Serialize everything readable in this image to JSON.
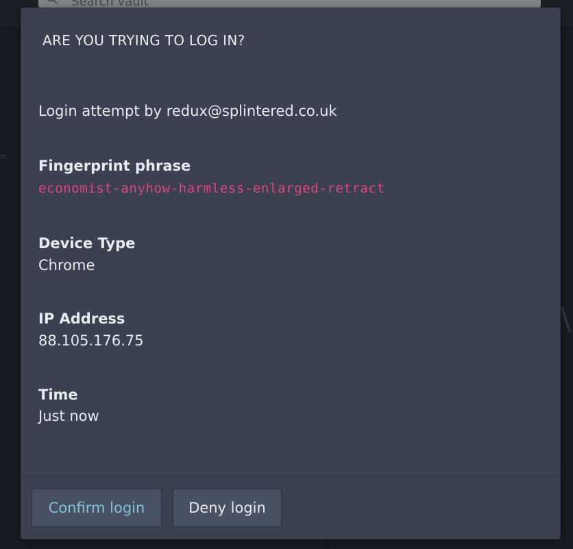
{
  "background": {
    "search_placeholder": "Search vault"
  },
  "dialog": {
    "title": "ARE YOU TRYING TO LOG IN?",
    "login_attempt": "Login attempt by redux@splintered.co.uk",
    "fields": [
      {
        "label": "Fingerprint phrase",
        "value": "economist-anyhow-harmless-enlarged-retract"
      },
      {
        "label": "Device Type",
        "value": "Chrome"
      },
      {
        "label": "IP Address",
        "value": "88.105.176.75"
      },
      {
        "label": "Time",
        "value": "Just now"
      }
    ],
    "buttons": {
      "confirm_label": "Confirm login",
      "deny_label": "Deny login"
    }
  },
  "colors": {
    "dialog_bg": "#3b4150",
    "fingerprint": "#e0467b",
    "confirm_text": "#7fc2d8",
    "button_bg": "#485264"
  }
}
